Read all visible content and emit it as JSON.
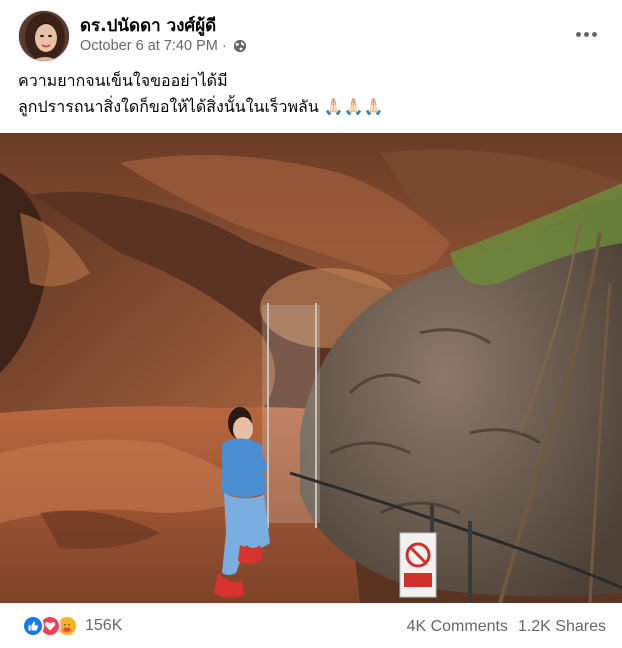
{
  "post": {
    "author_name": "ดร.ปนัดดา วงศ์ผู้ดี",
    "timestamp": "October 6 at 7:40 PM",
    "separator": "·",
    "privacy_icon": "globe-icon",
    "more_icon": "more-options-icon",
    "caption_lines": [
      "ความยากจนเข็นใจขออย่าได้มี",
      "ลูกปรารถนาสิ่งใดก็ขอให้ได้สิ่งนั้นในเร็วพลัน 🙏🏻🙏🏻🙏🏻"
    ],
    "photo_sign_icon": "no-entry-sign-icon"
  },
  "reactions": {
    "icons": [
      "like-icon",
      "love-icon",
      "care-icon"
    ],
    "count": "156K"
  },
  "stats": {
    "comments": "4K Comments",
    "shares": "1.2K Shares"
  },
  "colors": {
    "like": "#1877f2",
    "love": "#f33e58",
    "care": "#f7b125",
    "secondary_text": "#65676b"
  }
}
